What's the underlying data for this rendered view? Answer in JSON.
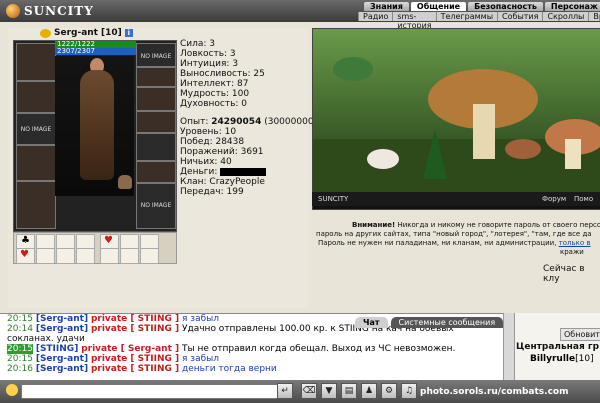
{
  "app": {
    "logo": "SUNCITY"
  },
  "nav": {
    "tabs": [
      "Знания",
      "Общение",
      "Безопасность",
      "Персонаж"
    ],
    "subtabs": [
      "Радио",
      "sms-история",
      "Телеграммы",
      "События",
      "Скроллы",
      "Ври"
    ]
  },
  "character": {
    "name": "Serg-ant",
    "level": "[10]",
    "hp": "1222/1222",
    "mp": "2307/2307",
    "no_image": "NO IMAGE"
  },
  "stats": {
    "rows": [
      "Сила: 3",
      "Ловкость: 3",
      "Интуиция: 3",
      "Выносливость: 25",
      "Интеллект: 87",
      "Мудрость: 100",
      "Духовность: 0"
    ],
    "exp_label": "Опыт:",
    "exp_value": "24290054",
    "exp_next": "(30000000)",
    "rows2": [
      "Уровень: 10",
      "Побед: 28438",
      "Поражений: 3691",
      "Ничьих: 40"
    ],
    "money_label": "Деньги:",
    "clan": "Клан: CrazyPeople",
    "transfers": "Передач: 199"
  },
  "scene": {
    "left": "SUNCITY",
    "links": [
      "Форум",
      "Помо"
    ]
  },
  "notice": {
    "bold": "Внимание!",
    "line1": "Никогда и никому не говорите пароль от своего персонаж",
    "line2": "пароль на других сайтах, типа \"новый город\", \"лотерея\", \"там, где все да",
    "line3": "Пароль не нужен ни паладинам, ни кланам, ни администрации,",
    "link": "только в",
    "line4": "кражи"
  },
  "session_text": "Сейчас в клу",
  "chat": {
    "tabs": [
      "Чат",
      "Системные сообщения"
    ],
    "lines": [
      {
        "time": "20:15",
        "from": "Serg-ant",
        "to": "STIING",
        "msg": "я забыл",
        "hl": false,
        "blue": true
      },
      {
        "time": "20:14",
        "from": "Serg-ant",
        "to": "STIING",
        "msg": "Удачно отправлены 100.00 кр. к STIING на кач на боевых",
        "hl": false,
        "blue": false
      },
      {
        "cont": "сокланах. удачи"
      },
      {
        "time": "20:15",
        "from": "STIING",
        "to": "Serg-ant",
        "msg": "Ты не отправил когда обещал. Выход из ЧС невозможен.",
        "hl": true,
        "blue": false
      },
      {
        "time": "20:15",
        "from": "Serg-ant",
        "to": "STIING",
        "msg": "я забыл",
        "hl": false,
        "blue": true
      },
      {
        "time": "20:16",
        "from": "Serg-ant",
        "to": "STIING",
        "msg": "деньги тогда верни",
        "hl": false,
        "blue": true
      }
    ],
    "private_word": "private"
  },
  "right": {
    "refresh": "Обновить",
    "center_label": "Центральная гр",
    "user_name": "Billyrulle",
    "user_level": "[10]"
  },
  "watermark": "photo.sorols.ru/combats.com"
}
